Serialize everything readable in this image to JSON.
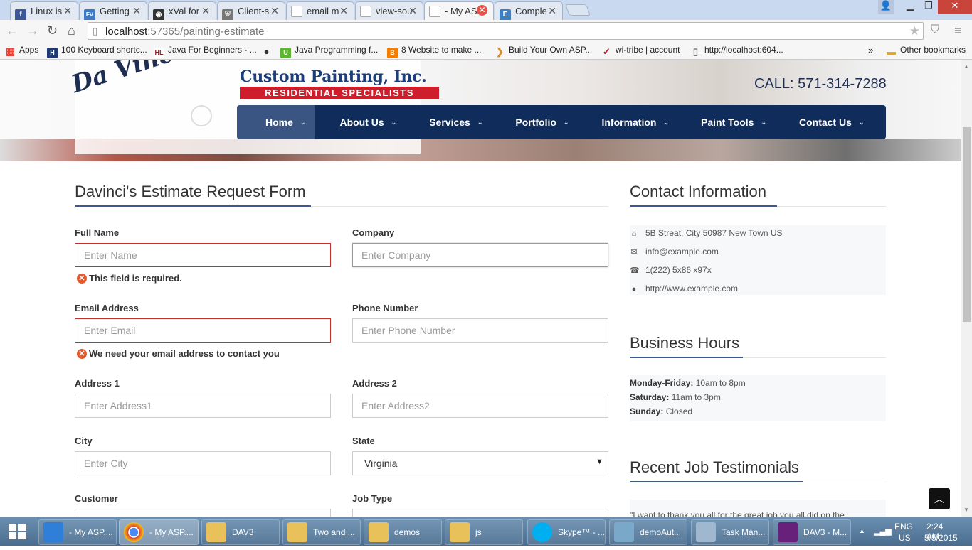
{
  "browser": {
    "tabs": [
      {
        "label": "Linux is",
        "icon": "facebook-icon",
        "color": "#3b5998",
        "glyph": "f"
      },
      {
        "label": "Getting",
        "icon": "fv-icon",
        "color": "#3d7ac9",
        "glyph": "FV"
      },
      {
        "label": "xVal for",
        "icon": "github-icon",
        "color": "#333333",
        "glyph": "◉"
      },
      {
        "label": "Client-s",
        "icon": "shield-icon",
        "color": "#777777",
        "glyph": "⛨"
      },
      {
        "label": "email m",
        "icon": "page-icon",
        "color": "#bbbbbb",
        "glyph": ""
      },
      {
        "label": "view-sou",
        "icon": "page-icon",
        "color": "#bbbbbb",
        "glyph": ""
      },
      {
        "label": "- My AS",
        "icon": "page-icon",
        "color": "#bbbbbb",
        "glyph": ""
      },
      {
        "label": "Comple",
        "icon": "e-icon",
        "color": "#3b7fc4",
        "glyph": "E"
      }
    ],
    "url": {
      "host": "localhost",
      "path": ":57365/painting-estimate"
    },
    "bookmarks": [
      {
        "label": "Apps",
        "color": "#e8443a",
        "glyph": "▦"
      },
      {
        "label": "100 Keyboard shortc...",
        "color": "#1d3a73",
        "glyph": "H"
      },
      {
        "label": "Java For Beginners - ...",
        "color": "#ffffff",
        "glyph": "HL"
      },
      {
        "label": "",
        "color": "#333333",
        "glyph": "●"
      },
      {
        "label": "Java Programming f...",
        "color": "#5cb531",
        "glyph": "U"
      },
      {
        "label": "8 Website to make ...",
        "color": "#f57d00",
        "glyph": "B"
      },
      {
        "label": "Build Your Own ASP...",
        "color": "#ffffff",
        "glyph": "❯"
      },
      {
        "label": "wi-tribe | account",
        "color": "#ffffff",
        "glyph": "✓"
      },
      {
        "label": "http://localhost:604...",
        "color": "#ffffff",
        "glyph": "▯"
      }
    ],
    "bookmarks_more": "»",
    "other_bookmarks": "Other bookmarks"
  },
  "header": {
    "logo_script": "Da Vinci's",
    "logo_main": "Custom Painting, Inc.",
    "logo_sub": "RESIDENTIAL SPECIALISTS",
    "call": "CALL: 571-314-7288",
    "nav": [
      {
        "label": "Home",
        "active": true
      },
      {
        "label": "About Us"
      },
      {
        "label": "Services"
      },
      {
        "label": "Portfolio"
      },
      {
        "label": "Information"
      },
      {
        "label": "Paint Tools"
      },
      {
        "label": "Contact Us"
      }
    ]
  },
  "form": {
    "title": "Davinci's Estimate Request Form",
    "full_name": {
      "label": "Full Name",
      "placeholder": "Enter Name",
      "error": "This field is required."
    },
    "company": {
      "label": "Company",
      "placeholder": "Enter Company"
    },
    "email": {
      "label": "Email Address",
      "placeholder": "Enter Email",
      "error": "We need your email address to contact you"
    },
    "phone": {
      "label": "Phone Number",
      "placeholder": "Enter Phone Number"
    },
    "address1": {
      "label": "Address 1",
      "placeholder": "Enter Address1"
    },
    "address2": {
      "label": "Address 2",
      "placeholder": "Enter Address2"
    },
    "city": {
      "label": "City",
      "placeholder": "Enter City"
    },
    "state": {
      "label": "State",
      "value": "Virginia"
    },
    "customer": {
      "label": "Customer"
    },
    "job_type": {
      "label": "Job Type"
    }
  },
  "sidebar": {
    "contact_title": "Contact Information",
    "contact": [
      {
        "icon": "home-icon",
        "text": "5B Streat, City 50987 New Town US"
      },
      {
        "icon": "envelope-icon",
        "text": "info@example.com"
      },
      {
        "icon": "phone-icon",
        "text": "1(222) 5x86 x97x"
      },
      {
        "icon": "globe-icon",
        "text": "http://www.example.com"
      }
    ],
    "hours_title": "Business Hours",
    "hours": [
      {
        "day": "Monday-Friday:",
        "time": "10am to 8pm"
      },
      {
        "day": "Saturday:",
        "time": "11am to 3pm"
      },
      {
        "day": "Sunday:",
        "time": "Closed"
      }
    ],
    "testimonials_title": "Recent Job Testimonials",
    "testimonial_text": "\"I want to thank you all for the great job you all did on the"
  },
  "taskbar": {
    "items": [
      {
        "label": "- My ASP....",
        "color": "#2f7fd8"
      },
      {
        "label": "- My ASP....",
        "color": "#db4437",
        "active": true
      },
      {
        "label": "DAV3",
        "color": "#e8c15a"
      },
      {
        "label": "Two and ...",
        "color": "#e8c15a"
      },
      {
        "label": "demos",
        "color": "#e8c15a"
      },
      {
        "label": "js",
        "color": "#e8c15a"
      },
      {
        "label": "Skype™ - ...",
        "color": "#00aff0"
      },
      {
        "label": "demoAut...",
        "color": "#7aa8c8"
      },
      {
        "label": "Task Man...",
        "color": "#9fb7cf"
      },
      {
        "label": "DAV3 - M...",
        "color": "#68217a"
      }
    ],
    "lang": "ENG",
    "region": "US",
    "time": "2:24 AM",
    "date": "5/5/2015"
  }
}
